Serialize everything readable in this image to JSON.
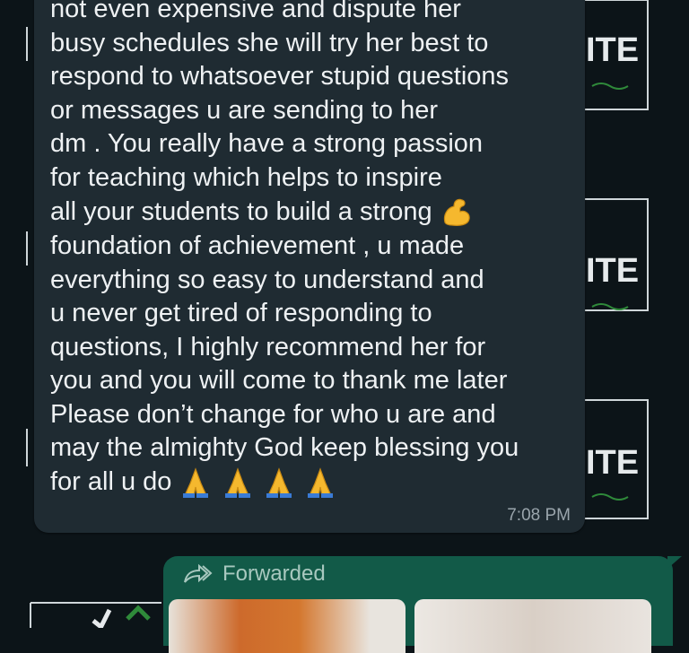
{
  "message": {
    "lines": [
      "not even expensive and dispute her",
      "busy schedules she will try her best to",
      "respond to whatsoever stupid questions",
      "or messages u are sending to her",
      "dm . You really have a strong passion",
      "for teaching which helps to inspire",
      "all your students to build a strong",
      "foundation of achievement , u made",
      "everything so easy to understand and",
      "u never get tired of responding to",
      "questions,  I highly recommend her for",
      "you and you will come to thank me later",
      "Please don’t change for who u are and",
      "may the almighty God keep blessing you",
      "for all u do"
    ],
    "time": "7:08 PM"
  },
  "wallpaper": {
    "tile_text": "ITE"
  },
  "forwarded": {
    "label": "Forwarded"
  },
  "colors": {
    "background": "#0c1418",
    "incoming_bubble": "#1f2b32",
    "outgoing_bubble": "#125a48",
    "timestamp": "#9aa5ac"
  }
}
